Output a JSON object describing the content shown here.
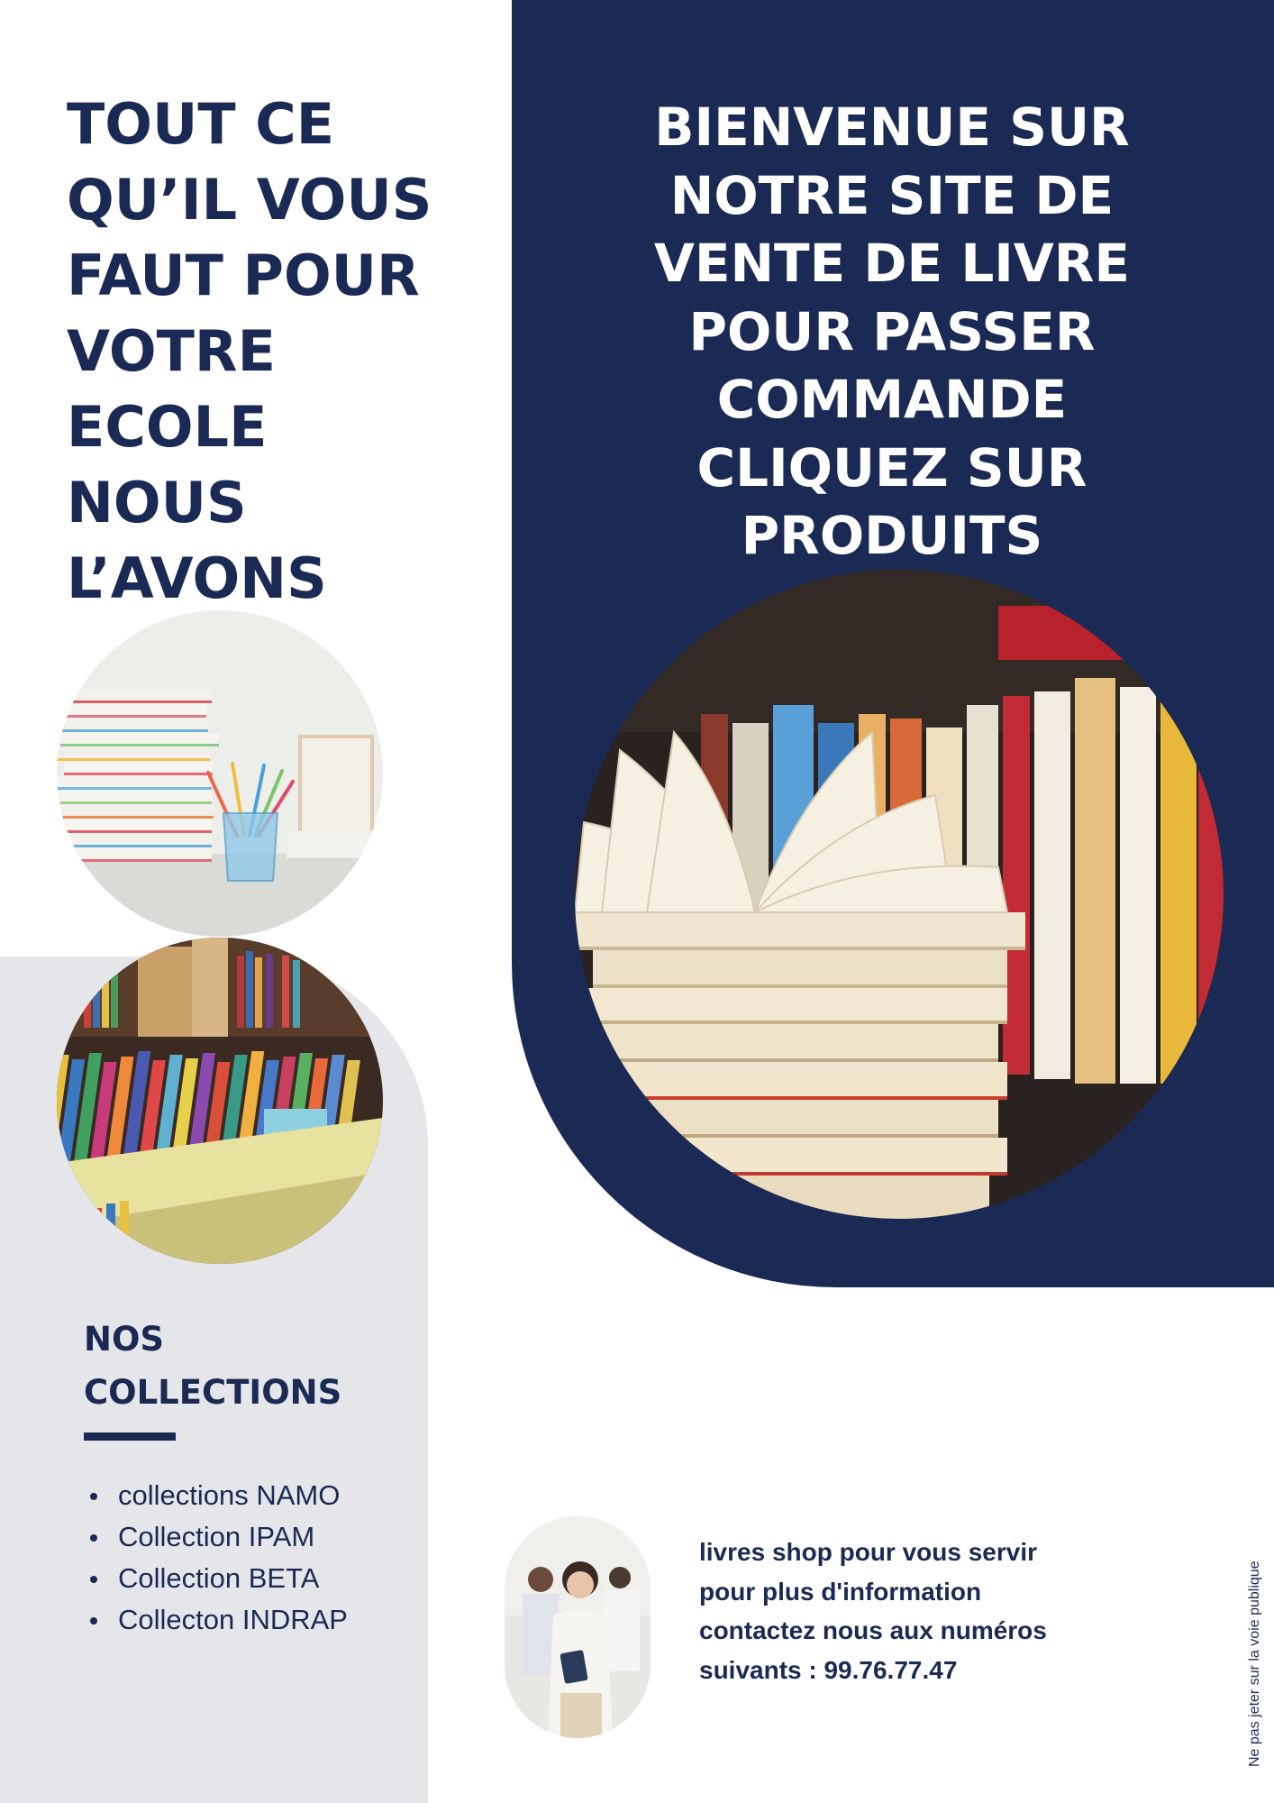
{
  "headline_left": [
    "TOUT CE",
    "QU’IL VOUS",
    "FAUT POUR",
    "VOTRE",
    "ECOLE",
    "NOUS",
    "L’AVONS"
  ],
  "headline_right": [
    "BIENVENUE SUR",
    "NOTRE SITE DE",
    "VENTE DE LIVRE",
    "POUR PASSER",
    "COMMANDE",
    "CLIQUEZ SUR",
    "PRODUITS"
  ],
  "collections": {
    "title": [
      "NOS",
      "COLLECTIONS"
    ],
    "items": [
      "collections NAMO",
      "Collection IPAM",
      "Collection BETA",
      "Collecton INDRAP"
    ]
  },
  "contact": [
    "livres shop pour vous servir",
    "pour plus d'information",
    "contactez nous aux numéros",
    "suivants : 99.76.77.47"
  ],
  "footer_note": "Ne pas jeter sur la voie publique",
  "colors": {
    "navy": "#1b2a54",
    "panel_gray": "#e5e6e9",
    "background": "#ffffff"
  },
  "images": [
    "stacked-books-with-pencil-cup-photo",
    "library-book-shelves-photo",
    "open-book-on-stack-photo",
    "smiling-woman-with-tablet-photo"
  ]
}
